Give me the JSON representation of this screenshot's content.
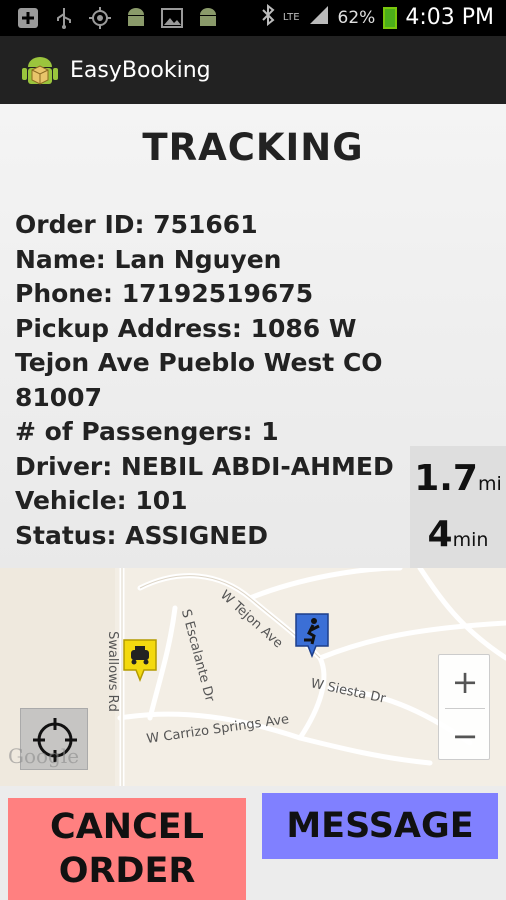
{
  "status_bar": {
    "battery": "62%",
    "time": "4:03 PM",
    "network": "LTE",
    "icons": [
      "add-icon",
      "usb-icon",
      "gps-icon",
      "android-icon",
      "image-icon",
      "android-icon",
      "bluetooth-icon",
      "network-icon",
      "signal-icon",
      "battery-icon"
    ]
  },
  "action_bar": {
    "app_title": "EasyBooking",
    "app_icon": "android-box-icon"
  },
  "tracking": {
    "title": "TRACKING",
    "order_id": "Order ID: 751661",
    "name": "Name: Lan Nguyen",
    "phone": "Phone: 17192519675",
    "pickup_line1": "Pickup Address: 1086 W",
    "pickup_line2": "Tejon Ave Pueblo West CO",
    "pickup_line3": "81007",
    "passengers": "# of Passengers: 1",
    "driver": "Driver: NEBIL ABDI-AHMED",
    "vehicle": "Vehicle: 101",
    "status": "Status: ASSIGNED"
  },
  "eta": {
    "distance": "1.7",
    "distance_unit": "mi",
    "time": "4",
    "time_unit": "min"
  },
  "map": {
    "labels": {
      "tejon": "W Tejon Ave",
      "swallows": "Swallows Rd",
      "escalante": "S Escalante Dr",
      "siesta": "W Siesta Dr",
      "carrizo": "W Carrizo Springs Ave"
    },
    "zoom_in": "+",
    "zoom_out": "−",
    "attribution": "Google"
  },
  "buttons": {
    "cancel": "CANCEL ORDER",
    "message": "MESSAGE"
  }
}
